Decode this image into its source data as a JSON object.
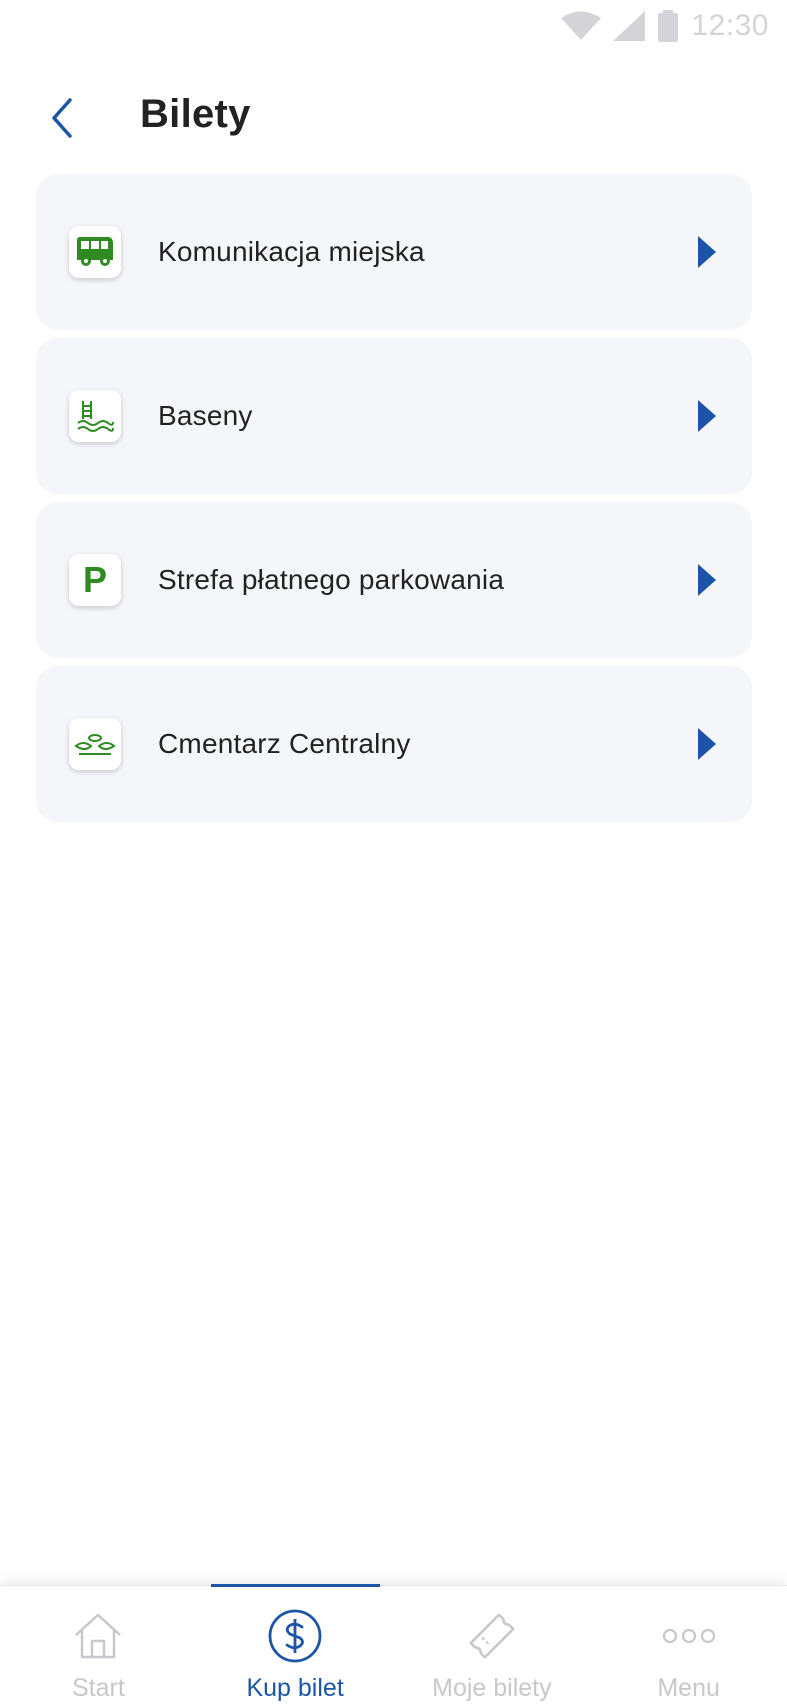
{
  "status_bar": {
    "time": "12:30"
  },
  "header": {
    "title": "Bilety"
  },
  "categories": [
    {
      "label": "Komunikacja miejska",
      "icon": "bus-icon"
    },
    {
      "label": "Baseny",
      "icon": "pool-icon"
    },
    {
      "label": "Strefa płatnego parkowania",
      "icon": "parking-icon",
      "icon_text": "P"
    },
    {
      "label": "Cmentarz Centralny",
      "icon": "cemetery-icon"
    }
  ],
  "bottom_nav": {
    "items": [
      {
        "label": "Start",
        "icon": "home-icon",
        "active": false
      },
      {
        "label": "Kup bilet",
        "icon": "dollar-icon",
        "active": true
      },
      {
        "label": "Moje bilety",
        "icon": "ticket-icon",
        "active": false
      },
      {
        "label": "Menu",
        "icon": "more-dots-icon",
        "active": false
      }
    ]
  },
  "colors": {
    "accent": "#1b56a6",
    "icon_green": "#2e8b22",
    "card_bg": "#f5f6fa",
    "inactive": "#c7c7cc"
  }
}
